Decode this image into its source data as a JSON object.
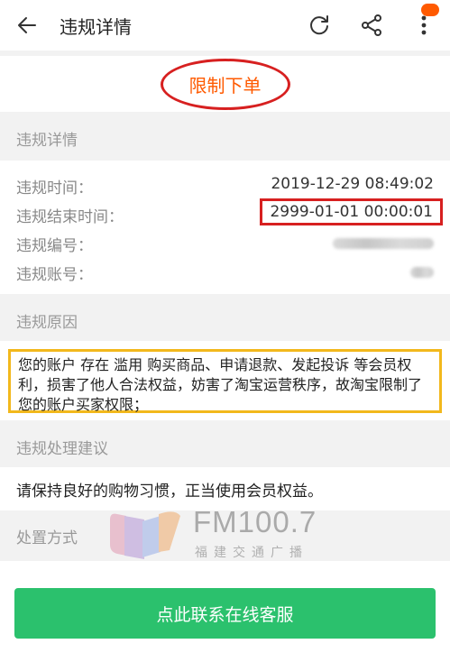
{
  "header": {
    "title": "违规详情"
  },
  "status": {
    "text": "限制下单"
  },
  "sections": {
    "details": "违规详情",
    "reason": "违规原因",
    "advice": "违规处理建议",
    "method": "处置方式"
  },
  "details": {
    "rows": [
      {
        "label": "违规时间：",
        "value": "2019-12-29 08:49:02"
      },
      {
        "label": "违规结束时间：",
        "value": "2999-01-01 00:00:01"
      },
      {
        "label": "违规编号：",
        "value": ""
      },
      {
        "label": "违规账号：",
        "value": ""
      }
    ]
  },
  "reason": {
    "text": "您的账户 存在 滥用 购买商品、申请退款、发起投诉 等会员权利，损害了他人合法权益，妨害了淘宝运营秩序，故淘宝限制了您的账户买家权限；"
  },
  "advice": {
    "text": "请保持良好的购物习惯，正当使用会员权益。"
  },
  "watermark": {
    "title": "FM100.7",
    "subtitle": "福建交通广播"
  },
  "bottom": {
    "button_label": "点此联系在线客服"
  },
  "colors": {
    "accent": "#ff5a00",
    "primary_button": "#2bc16d",
    "circle_annotation": "#d72020",
    "highlight_box": "#f2b81c"
  },
  "icons": {
    "back": "back-arrow-icon",
    "refresh": "refresh-icon",
    "share": "share-icon",
    "more": "more-vertical-icon"
  }
}
